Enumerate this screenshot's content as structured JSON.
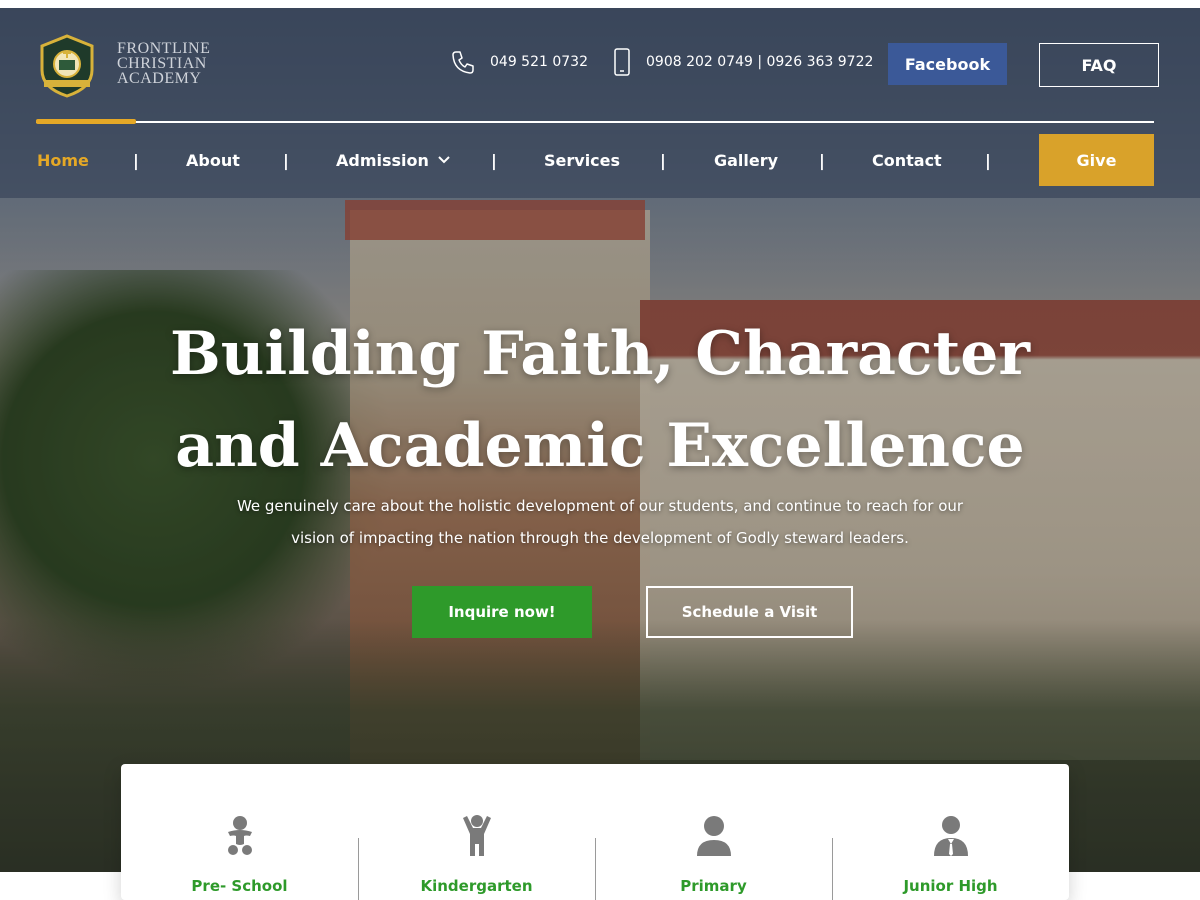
{
  "header": {
    "logo": {
      "icon": "school-crest-icon",
      "name_lines": [
        "FRONTLINE",
        "CHRISTIAN",
        "ACADEMY"
      ]
    },
    "contacts": {
      "phone": {
        "icon": "phone-icon",
        "text": "049 521 0732"
      },
      "mobile": {
        "icon": "mobile-icon",
        "text": "0908 202 0749 | 0926 363 9722"
      }
    },
    "facebook_label": "Facebook",
    "faq_label": "FAQ",
    "give_label": "Give"
  },
  "nav": {
    "separator": "|",
    "items": [
      {
        "label": "Home",
        "active": true
      },
      {
        "label": "About",
        "active": false
      },
      {
        "label": "Admission",
        "active": false,
        "dropdown": true
      },
      {
        "label": "Services",
        "active": false
      },
      {
        "label": "Gallery",
        "active": false
      },
      {
        "label": "Contact",
        "active": false
      }
    ]
  },
  "hero": {
    "title_lines": [
      "Building Faith, Character",
      "and Academic Excellence"
    ],
    "subtitle_lines": [
      "We genuinely care about the holistic development of our students, and continue to reach for our",
      "vision of impacting the nation through the development of Godly steward leaders."
    ],
    "inquire_label": "Inquire now!",
    "visit_label": "Schedule a Visit"
  },
  "programs": [
    {
      "label": "Pre- School",
      "icon": "baby-icon"
    },
    {
      "label": "Kindergarten",
      "icon": "child-icon"
    },
    {
      "label": "Primary",
      "icon": "student-icon"
    },
    {
      "label": "Junior High",
      "icon": "teen-suit-icon"
    }
  ],
  "colors": {
    "accent_gold": "#e5a826",
    "give_gold": "#d9a22a",
    "facebook_blue": "#3b5998",
    "green": "#2e9a2a"
  }
}
